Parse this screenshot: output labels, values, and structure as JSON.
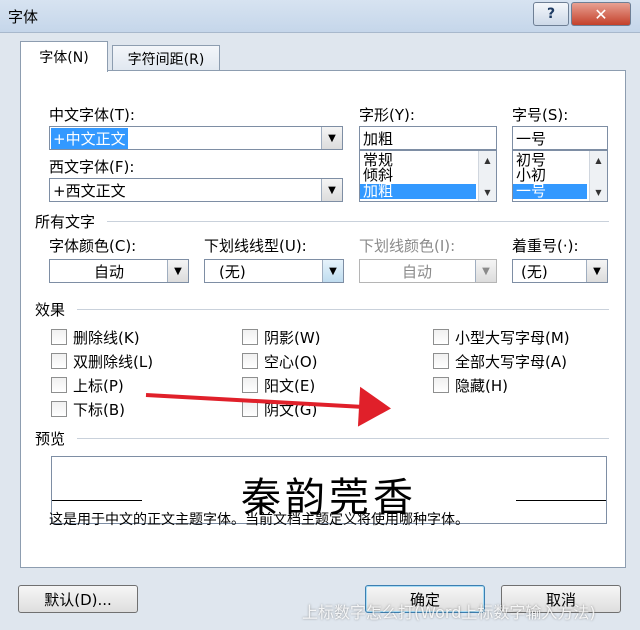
{
  "window": {
    "title": "字体",
    "help": "?",
    "close": "✕"
  },
  "tabs": [
    {
      "label": "字体(N)"
    },
    {
      "label": "字符间距(R)"
    }
  ],
  "font": {
    "cn_label": "中文字体(T):",
    "cn_value": "+中文正文",
    "west_label": "西文字体(F):",
    "west_value": "+西文正文",
    "style_label": "字形(Y):",
    "style_value": "加粗",
    "style_list": [
      "常规",
      "倾斜",
      "加粗"
    ],
    "size_label": "字号(S):",
    "size_value": "一号",
    "size_list": [
      "初号",
      "小初",
      "一号"
    ]
  },
  "all_text": {
    "section": "所有文字",
    "color_label": "字体颜色(C):",
    "color_value": "自动",
    "underline_label": "下划线线型(U):",
    "underline_value": "(无)",
    "underline_color_label": "下划线颜色(I):",
    "underline_color_value": "自动",
    "emphasis_label": "着重号(·):",
    "emphasis_value": "(无)"
  },
  "effects": {
    "section": "效果",
    "col1": [
      "删除线(K)",
      "双删除线(L)",
      "上标(P)",
      "下标(B)"
    ],
    "col2": [
      "阴影(W)",
      "空心(O)",
      "阳文(E)",
      "阴文(G)"
    ],
    "col3": [
      "小型大写字母(M)",
      "全部大写字母(A)",
      "隐藏(H)"
    ]
  },
  "preview": {
    "section": "预览",
    "sample": "秦韵莞香",
    "description": "这是用于中文的正文主题字体。当前文档主题定义将使用哪种字体。"
  },
  "buttons": {
    "default": "默认(D)...",
    "ok": "确定",
    "cancel": "取消"
  },
  "watermark": "上标数字怎么打(Word上标数字输入方法)",
  "colors": {
    "annotation_arrow": "#e0202a",
    "selection": "#3399ff"
  }
}
